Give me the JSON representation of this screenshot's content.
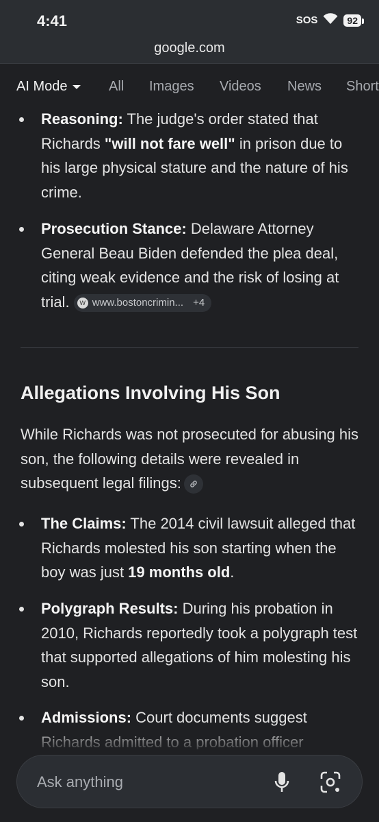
{
  "status": {
    "time": "4:41",
    "sos": "SOS",
    "battery": "92"
  },
  "url": "google.com",
  "tabs": [
    "AI Mode",
    "All",
    "Images",
    "Videos",
    "News",
    "Short"
  ],
  "bullets_top": [
    {
      "label": "Reasoning:",
      "pre": " The judge's order stated that Richards ",
      "bold_mid": "\"will not fare well\"",
      "post": " in prison due to his large physical stature and the nature of his crime."
    },
    {
      "label": "Prosecution Stance:",
      "text": " Delaware Attorney General Beau Biden defended the plea deal, citing weak evidence and the risk of losing at trial. ",
      "source": "www.bostoncrimin...",
      "source_count": "+4"
    }
  ],
  "section": {
    "heading": "Allegations Involving His Son",
    "intro": "While Richards was not prosecuted for abusing his son, the following details were revealed in subsequent legal filings:"
  },
  "bullets_bottom": [
    {
      "label": "The Claims:",
      "pre": " The 2014 civil lawsuit alleged that Richards molested his son starting when the boy was just ",
      "bold_mid": "19 months old",
      "post": "."
    },
    {
      "label": "Polygraph Results:",
      "text": " During his probation in 2010, Richards reportedly took a polygraph test that supported allegations of him molesting his son."
    },
    {
      "label": "Admissions:",
      "text": " Court documents suggest Richards admitted to a probation officer"
    }
  ],
  "ask": {
    "placeholder": "Ask anything"
  },
  "icons": {
    "mic": "mic-icon",
    "lens": "lens-icon",
    "wifi": "wifi-icon",
    "link": "link-icon",
    "source": "source-favicon-icon"
  }
}
